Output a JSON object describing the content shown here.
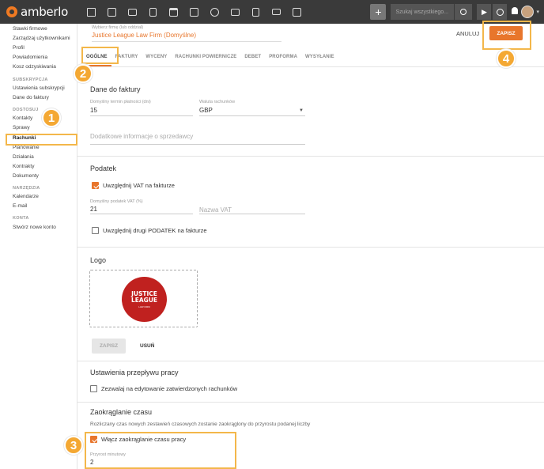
{
  "app": {
    "name": "amberlo"
  },
  "topbar": {
    "nav_icons": [
      "dashboard-icon",
      "contacts-icon",
      "briefcase-icon",
      "document-icon",
      "bank-icon",
      "calendar-icon",
      "clock-icon",
      "folder-icon",
      "notes-icon",
      "mail-icon",
      "grid-icon"
    ],
    "plus": "+",
    "search_placeholder": "Szukaj wszystkiego...",
    "search_icon": "🔍",
    "play_icon": "▶",
    "timer_icon": "⏱",
    "bell_icon": "🔔",
    "caret": "▾"
  },
  "sidebar": {
    "items_top": [
      "Stawki firmowe",
      "Zarządzaj użytkownikami",
      "Profil",
      "Powiadomienia",
      "Kosz odzyskiwania"
    ],
    "subskrypcja_header": "SUBSKRYPCJA",
    "subskrypcja_items": [
      "Ustawienia subskrypcji",
      "Dane do faktury"
    ],
    "dostosuj_header": "DOSTOSUJ",
    "dostosuj_items": [
      "Kontakty",
      "Sprawy",
      "Rachunki",
      "Planowanie",
      "Działania",
      "Kontrakty",
      "Dokumenty"
    ],
    "narzedzia_header": "NARZĘDZIA",
    "narzedzia_items": [
      "Kalendarze",
      "E-mail"
    ],
    "konto_header": "KONTA",
    "konto_items": [
      "Stwórz nowe konto"
    ]
  },
  "header": {
    "firm_label": "Wybierz firmę (lub oddział)",
    "firm_value": "Justice League Law Firm (Domyślne)",
    "cancel": "ANULUJ",
    "save": "ZAPISZ"
  },
  "tabs": [
    "OGÓLNE",
    "FAKTURY",
    "WYCENY",
    "RACHUNKI POWIERNICZE",
    "DEBET",
    "PROFORMA",
    "WYSYŁANIE"
  ],
  "invoice_data": {
    "title": "Dane do faktury",
    "due_label": "Domyślny termin płatności (dni)",
    "due_value": "15",
    "currency_label": "Waluta rachunków",
    "currency_value": "GBP",
    "sales_info_placeholder": "Dodatkowe informacje o sprzedawcy"
  },
  "tax": {
    "title": "Podatek",
    "include_vat": "Uwzględnij VAT na fakturze",
    "vat_label": "Domyślny podatek VAT (%)",
    "vat_value": "21",
    "vat_name_placeholder": "Nazwa VAT",
    "second_tax": "Uwzględnij drugi PODATEK na fakturze"
  },
  "logo": {
    "title": "Logo",
    "logo_line1": "JUSTICE",
    "logo_line2": "LEAGUE",
    "logo_line3": "LAW FIRM",
    "save": "ZAPISZ",
    "remove": "USUŃ"
  },
  "workflow": {
    "title": "Ustawienia przepływu pracy",
    "allow_edit": "Zezwalaj na edytowanie zatwierdzonych rachunków"
  },
  "rounding": {
    "title": "Zaokrąglanie czasu",
    "description": "Rozliczany czas nowych zestawień czasowych zostanie zaokrąglony do przyrostu podanej liczby",
    "enable": "Włącz zaokrąglanie czasu pracy",
    "increment_label": "Przyrost minutowy",
    "increment_value": "2"
  },
  "callouts": [
    "1",
    "2",
    "3",
    "4"
  ],
  "colors": {
    "accent": "#e8762c",
    "callout": "#f4a833",
    "topbar": "#3a3a3a"
  }
}
